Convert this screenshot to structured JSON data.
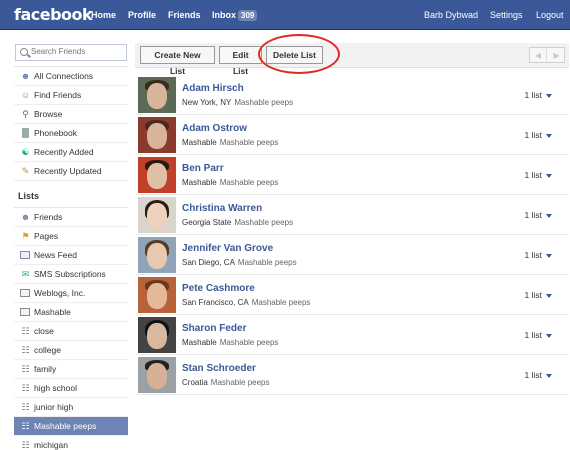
{
  "header": {
    "logo": "facebook",
    "nav": {
      "home": "Home",
      "profile": "Profile",
      "friends": "Friends",
      "inbox": "Inbox",
      "inbox_count": "309"
    },
    "user": "Barb Dybwad",
    "settings": "Settings",
    "logout": "Logout"
  },
  "sidebar": {
    "search_placeholder": "Search Friends",
    "items": [
      {
        "label": "All Connections",
        "icon": "people-icon"
      },
      {
        "label": "Find Friends",
        "icon": "find-friends-icon"
      },
      {
        "label": "Browse",
        "icon": "magnifier-icon"
      },
      {
        "label": "Phonebook",
        "icon": "phone-icon"
      },
      {
        "label": "Recently Added",
        "icon": "recently-added-icon"
      },
      {
        "label": "Recently Updated",
        "icon": "pencil-icon"
      }
    ],
    "lists_heading": "Lists",
    "lists": [
      {
        "label": "Friends",
        "icon": "people-icon"
      },
      {
        "label": "Pages",
        "icon": "pages-icon"
      },
      {
        "label": "News Feed",
        "icon": "news-feed-icon"
      },
      {
        "label": "SMS Subscriptions",
        "icon": "sms-icon"
      },
      {
        "label": "Weblogs, Inc.",
        "icon": "list-icon"
      },
      {
        "label": "Mashable",
        "icon": "list-icon"
      },
      {
        "label": "close",
        "icon": "contact-list-icon"
      },
      {
        "label": "college",
        "icon": "contact-list-icon"
      },
      {
        "label": "family",
        "icon": "contact-list-icon"
      },
      {
        "label": "high school",
        "icon": "contact-list-icon"
      },
      {
        "label": "junior high",
        "icon": "contact-list-icon"
      },
      {
        "label": "Mashable peeps",
        "icon": "contact-list-icon",
        "selected": true
      },
      {
        "label": "michigan",
        "icon": "contact-list-icon"
      }
    ]
  },
  "toolbar": {
    "create_label": "Create New List",
    "edit_label": "Edit List",
    "delete_label": "Delete List",
    "prev_label": "◀",
    "next_label": "▶"
  },
  "friends": [
    {
      "name": "Adam Hirsch",
      "network": "New York, NY",
      "list": "Mashable peeps",
      "count": "1 list"
    },
    {
      "name": "Adam Ostrow",
      "network": "Mashable",
      "list": "Mashable peeps",
      "count": "1 list"
    },
    {
      "name": "Ben Parr",
      "network": "Mashable",
      "list": "Mashable peeps",
      "count": "1 list"
    },
    {
      "name": "Christina Warren",
      "network": "Georgia State",
      "list": "Mashable peeps",
      "count": "1 list"
    },
    {
      "name": "Jennifer Van Grove",
      "network": "San Diego, CA",
      "list": "Mashable peeps",
      "count": "1 list"
    },
    {
      "name": "Pete Cashmore",
      "network": "San Francisco, CA",
      "list": "Mashable peeps",
      "count": "1 list"
    },
    {
      "name": "Sharon Feder",
      "network": "Mashable",
      "list": "Mashable peeps",
      "count": "1 list"
    },
    {
      "name": "Stan Schroeder",
      "network": "Croatia",
      "list": "Mashable peeps",
      "count": "1 list"
    }
  ],
  "colors": {
    "brand": "#3b5998",
    "selected": "#6d84b4",
    "highlight": "#e02a1c"
  }
}
